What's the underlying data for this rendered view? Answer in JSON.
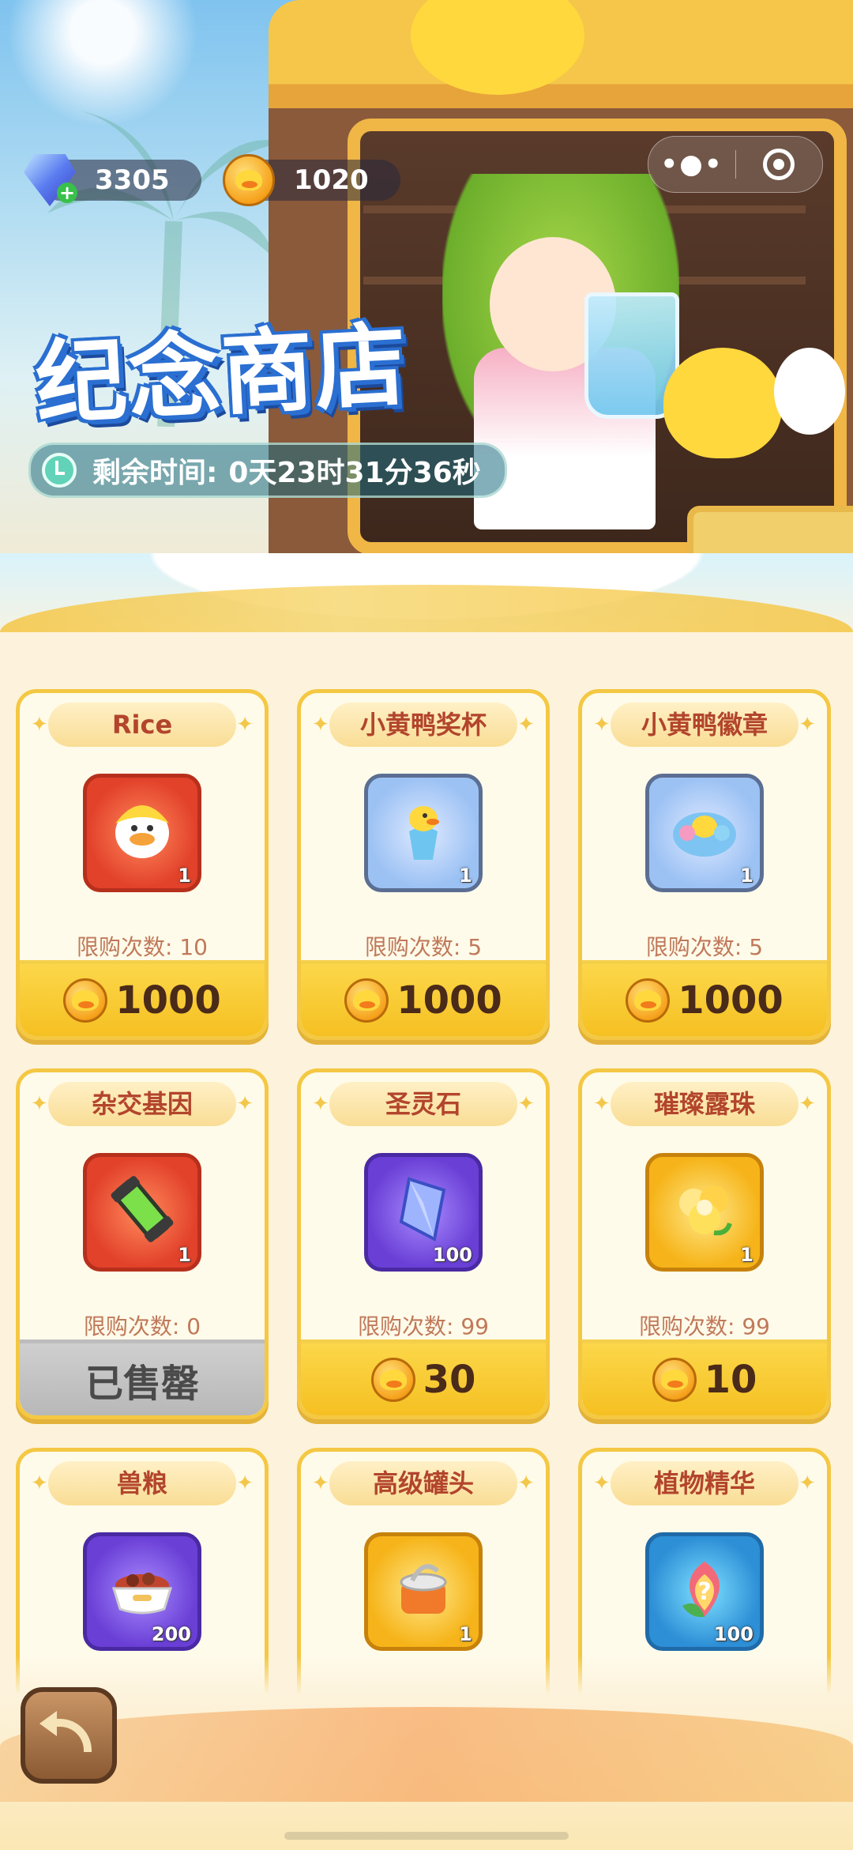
{
  "currency": {
    "gems": "3305",
    "coins": "1020"
  },
  "banner": {
    "title": "纪念商店",
    "timer_label": "剩余时间:",
    "timer_value": "0天23时31分36秒"
  },
  "items": [
    {
      "name": "Rice",
      "count": "1",
      "limit": "限购次数: 10",
      "price": "1000",
      "soldout": false,
      "frame": "red"
    },
    {
      "name": "小黄鸭奖杯",
      "count": "1",
      "limit": "限购次数: 5",
      "price": "1000",
      "soldout": false,
      "frame": "blue"
    },
    {
      "name": "小黄鸭徽章",
      "count": "1",
      "limit": "限购次数: 5",
      "price": "1000",
      "soldout": false,
      "frame": "blue"
    },
    {
      "name": "杂交基因",
      "count": "1",
      "limit": "限购次数: 0",
      "price": "已售罄",
      "soldout": true,
      "frame": "red"
    },
    {
      "name": "圣灵石",
      "count": "100",
      "limit": "限购次数: 99",
      "price": "30",
      "soldout": false,
      "frame": "purple"
    },
    {
      "name": "璀璨露珠",
      "count": "1",
      "limit": "限购次数: 99",
      "price": "10",
      "soldout": false,
      "frame": "gold"
    },
    {
      "name": "兽粮",
      "count": "200",
      "frame": "purple"
    },
    {
      "name": "高级罐头",
      "count": "1",
      "frame": "gold"
    },
    {
      "name": "植物精华",
      "count": "100",
      "frame": "cyan"
    }
  ],
  "icons": {
    "gem": "gem-plus-icon",
    "coin": "duck-coin-icon",
    "menu": "more-dots-icon",
    "close": "target-circle-icon",
    "back": "back-arrow-icon",
    "clock": "clock-icon"
  },
  "colors": {
    "accent": "#f5c022",
    "title_text": "#b2452c",
    "limit_text": "#c0795a",
    "soldout": "#b8b8b8"
  }
}
